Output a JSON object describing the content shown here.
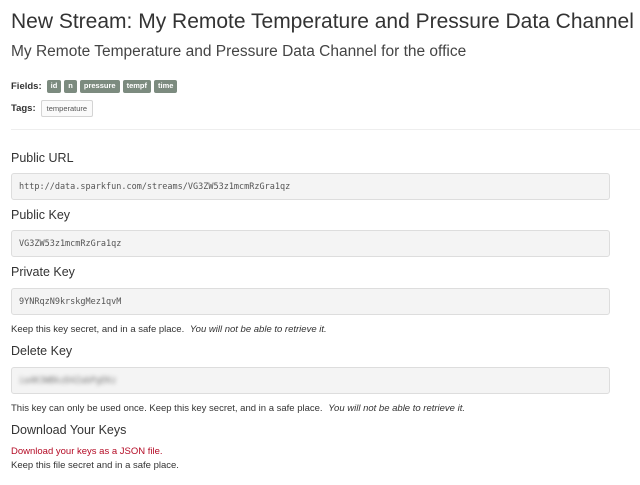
{
  "stream": {
    "title": "New Stream: My Remote Temperature and Pressure Data Channel",
    "description": "My Remote Temperature and Pressure Data Channel for the office"
  },
  "fields": {
    "label": "Fields:",
    "items": [
      "id",
      "n",
      "pressure",
      "tempf",
      "time"
    ]
  },
  "tags": {
    "label": "Tags:",
    "items": [
      "temperature"
    ]
  },
  "public_url": {
    "label": "Public URL",
    "value": "http://data.sparkfun.com/streams/VG3ZW53z1mcmRzGra1qz"
  },
  "public_key": {
    "label": "Public Key",
    "value": "VG3ZW53z1mcmRzGra1qz"
  },
  "private_key": {
    "label": "Private Key",
    "value": "9YNRqzN9krskgMez1qvM",
    "note": "Keep this key secret, and in a safe place.",
    "warning": "You will not be able to retrieve it."
  },
  "delete_key": {
    "label": "Delete Key",
    "value": "ia4K3WBkzD4ZabPgEKz",
    "note": "This key can only be used once.  Keep this key secret, and in a safe place.",
    "warning": "You will not be able to retrieve it."
  },
  "download": {
    "heading": "Download Your Keys",
    "link_text": "Download your keys as a JSON file",
    "link_suffix": ".",
    "note": "Keep this file secret and in a safe place."
  },
  "colors": {
    "field_badge": "#7c8b7f",
    "link": "#b40b25",
    "input_background": "#f4f4f4"
  }
}
